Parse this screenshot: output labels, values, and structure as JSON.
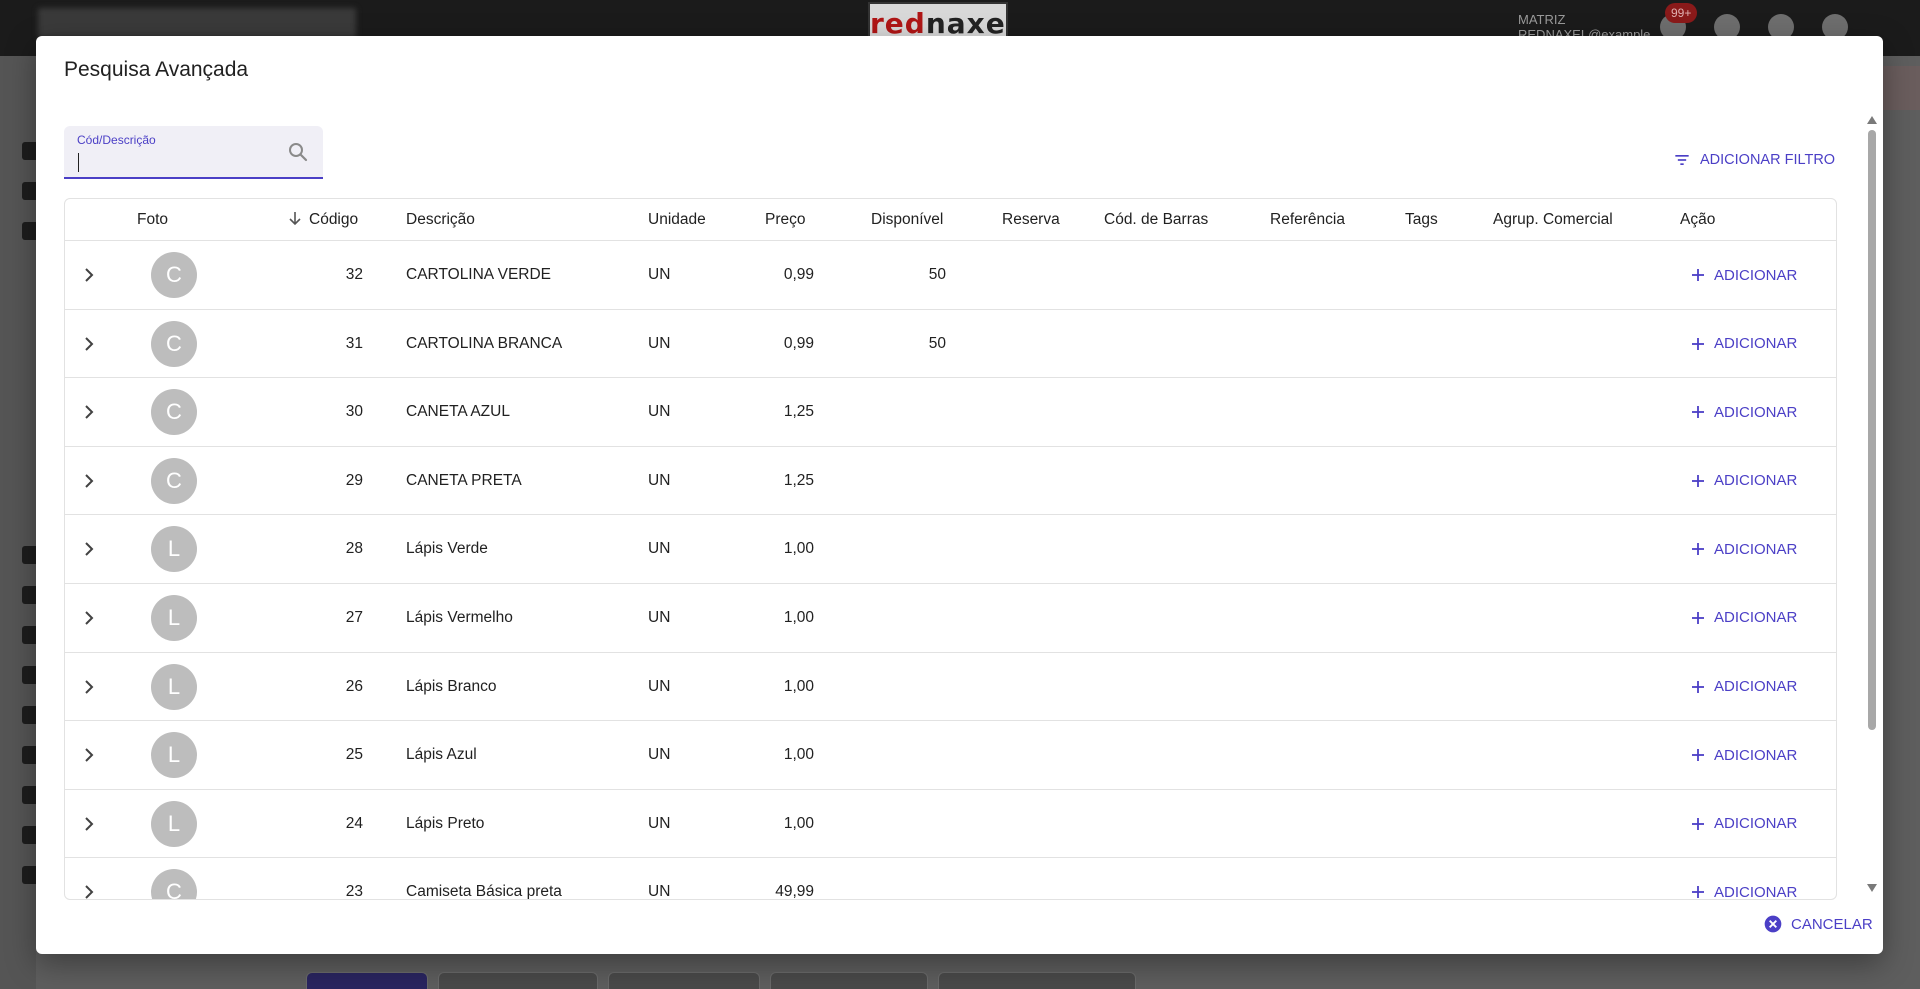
{
  "background": {
    "logo_red": "red",
    "logo_dark": "naxel",
    "user_line1": "MATRIZ",
    "user_line2": "REDNAXEL@example",
    "notification_badge": "99+"
  },
  "dialog": {
    "title": "Pesquisa Avançada",
    "search": {
      "label": "Cód/Descrição",
      "value": ""
    },
    "add_filter_label": "ADICIONAR FILTRO",
    "cancel_label": "CANCELAR"
  },
  "table": {
    "headers": {
      "foto": "Foto",
      "codigo": "Código",
      "descricao": "Descrição",
      "unidade": "Unidade",
      "preco": "Preço",
      "disponivel": "Disponível",
      "reserva": "Reserva",
      "cod_barras": "Cód. de Barras",
      "referencia": "Referência",
      "tags": "Tags",
      "agrup_comercial": "Agrup. Comercial",
      "acao": "Ação"
    },
    "action_label": "ADICIONAR",
    "rows": [
      {
        "avatar": "C",
        "codigo": "32",
        "descricao": "CARTOLINA VERDE",
        "unidade": "UN",
        "preco": "0,99",
        "disponivel": "50"
      },
      {
        "avatar": "C",
        "codigo": "31",
        "descricao": "CARTOLINA BRANCA",
        "unidade": "UN",
        "preco": "0,99",
        "disponivel": "50"
      },
      {
        "avatar": "C",
        "codigo": "30",
        "descricao": "CANETA AZUL",
        "unidade": "UN",
        "preco": "1,25",
        "disponivel": ""
      },
      {
        "avatar": "C",
        "codigo": "29",
        "descricao": "CANETA PRETA",
        "unidade": "UN",
        "preco": "1,25",
        "disponivel": ""
      },
      {
        "avatar": "L",
        "codigo": "28",
        "descricao": "Lápis Verde",
        "unidade": "UN",
        "preco": "1,00",
        "disponivel": ""
      },
      {
        "avatar": "L",
        "codigo": "27",
        "descricao": "Lápis Vermelho",
        "unidade": "UN",
        "preco": "1,00",
        "disponivel": ""
      },
      {
        "avatar": "L",
        "codigo": "26",
        "descricao": "Lápis Branco",
        "unidade": "UN",
        "preco": "1,00",
        "disponivel": ""
      },
      {
        "avatar": "L",
        "codigo": "25",
        "descricao": "Lápis Azul",
        "unidade": "UN",
        "preco": "1,00",
        "disponivel": ""
      },
      {
        "avatar": "L",
        "codigo": "24",
        "descricao": "Lápis Preto",
        "unidade": "UN",
        "preco": "1,00",
        "disponivel": ""
      },
      {
        "avatar": "C",
        "codigo": "23",
        "descricao": "Camiseta Básica preta",
        "unidade": "UN",
        "preco": "49,99",
        "disponivel": ""
      }
    ]
  },
  "colors": {
    "accent": "#4b3fc6",
    "avatar_bg": "#bdbdbd",
    "divider": "#e2e2e2"
  }
}
